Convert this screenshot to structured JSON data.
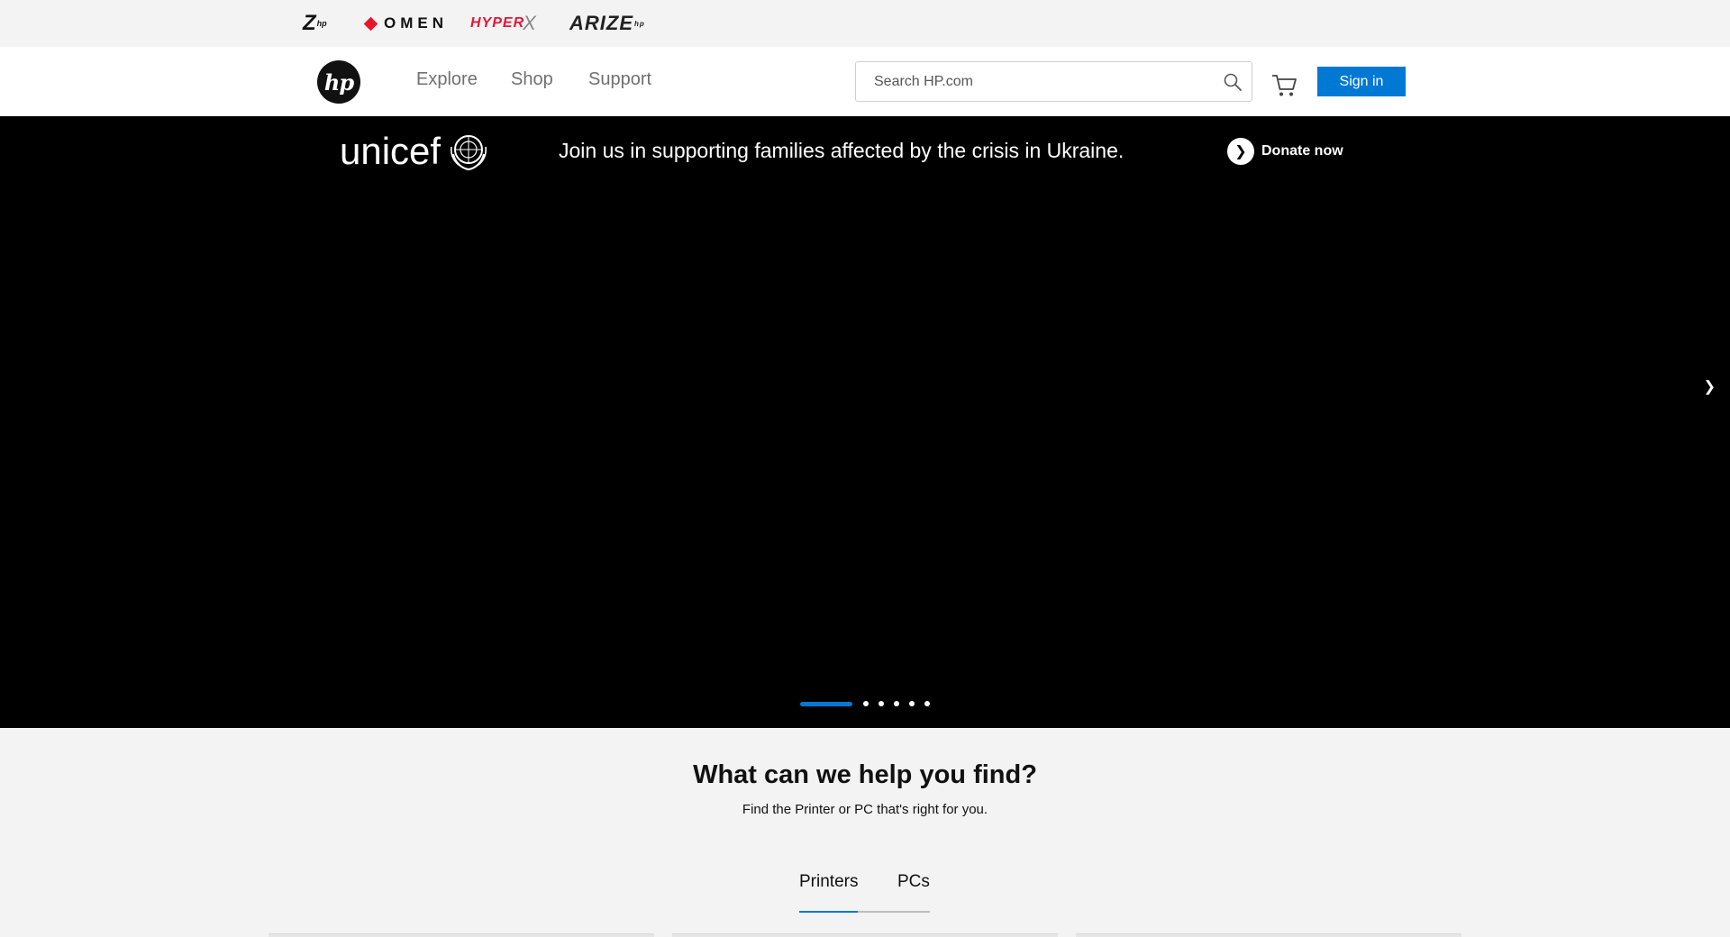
{
  "brand_bar": {
    "z": "Z",
    "z_sup": "hp",
    "omen": "OMEN",
    "hyperx": "HYPER",
    "hyperx_x": "X",
    "arize": "ARIZE",
    "arize_sup": "hp"
  },
  "header": {
    "logo": "hp",
    "nav": [
      "Explore",
      "Shop",
      "Support"
    ],
    "search_placeholder": "Search HP.com",
    "signin_label": "Sign in"
  },
  "hero": {
    "partner": "unicef",
    "message": "Join us in supporting families affected by the crisis in Ukraine.",
    "donate_label": "Donate now",
    "slide_count": 6,
    "active_slide": 1
  },
  "find": {
    "title": "What can we help you find?",
    "subtitle": "Find the Printer or PC that's right for you.",
    "tabs": [
      "Printers",
      "PCs"
    ],
    "active_tab": "Printers"
  },
  "colors": {
    "accent": "#0278d5",
    "omen_red": "#e8162b",
    "hyperx_red": "#e31837"
  }
}
